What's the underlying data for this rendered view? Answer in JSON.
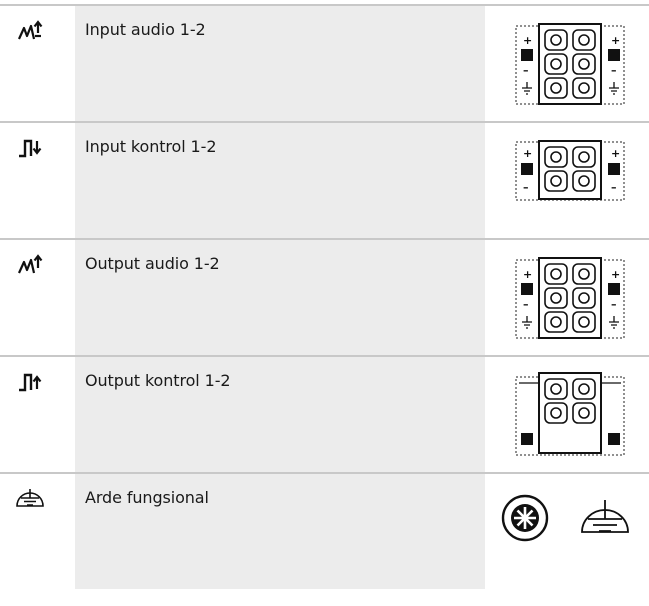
{
  "rows": [
    {
      "icon": "audio-input-icon",
      "label": "Input audio 1-2",
      "picture": "audio-input-connector"
    },
    {
      "icon": "control-input-icon",
      "label": "Input kontrol 1-2",
      "picture": "control-input-connector"
    },
    {
      "icon": "audio-output-icon",
      "label": "Output audio 1-2",
      "picture": "audio-output-connector"
    },
    {
      "icon": "control-output-icon",
      "label": "Output kontrol 1-2",
      "picture": "control-output-connector"
    },
    {
      "icon": "functional-earth-icon",
      "label": "Arde fungsional",
      "picture": "earth-screw-and-symbol"
    }
  ]
}
